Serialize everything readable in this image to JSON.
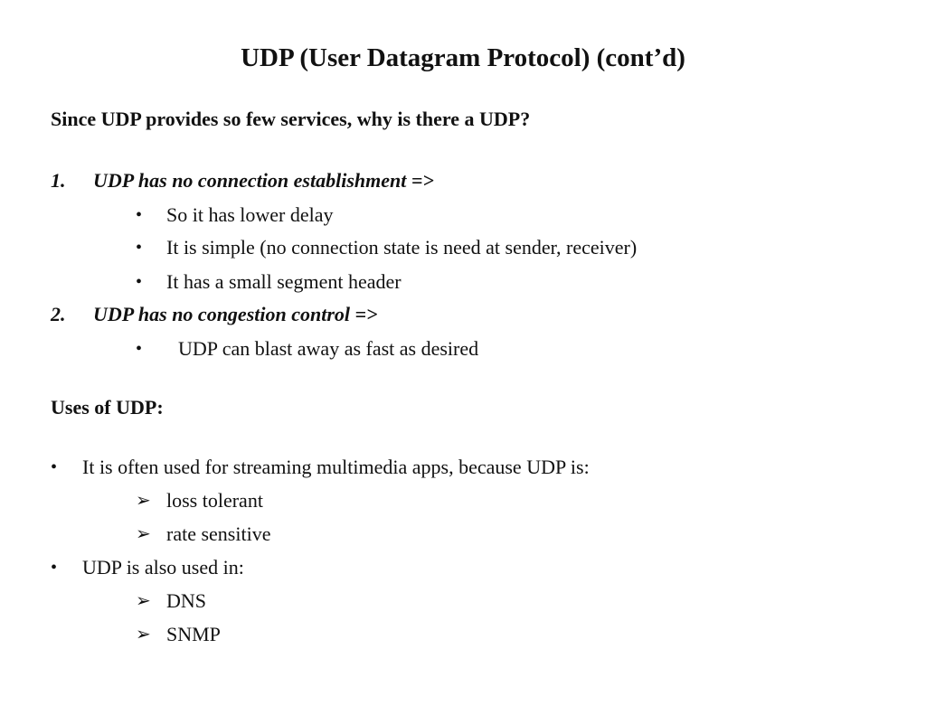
{
  "slide": {
    "title": "UDP (User Datagram Protocol) (cont’d)",
    "question": "Since UDP provides so few services, why is there a UDP?",
    "reasons": [
      {
        "number": "1.",
        "heading": "UDP has no connection establishment  =>",
        "bullets": [
          "So it has lower delay",
          "It is simple (no connection state is need at sender, receiver)",
          "It has a small segment header"
        ]
      },
      {
        "number": "2.",
        "heading": "UDP has no congestion control  =>",
        "bullets": [
          "UDP can blast away as fast as desired"
        ]
      }
    ],
    "uses_heading": "Uses of UDP:",
    "uses": [
      {
        "text": "It is often used for streaming multimedia apps, because UDP is:",
        "subitems": [
          "loss tolerant",
          "rate sensitive"
        ]
      },
      {
        "text": "UDP is also used in:",
        "subitems": [
          "DNS",
          "SNMP"
        ]
      }
    ],
    "bullet_glyph": "•",
    "arrow_glyph": "➢"
  }
}
